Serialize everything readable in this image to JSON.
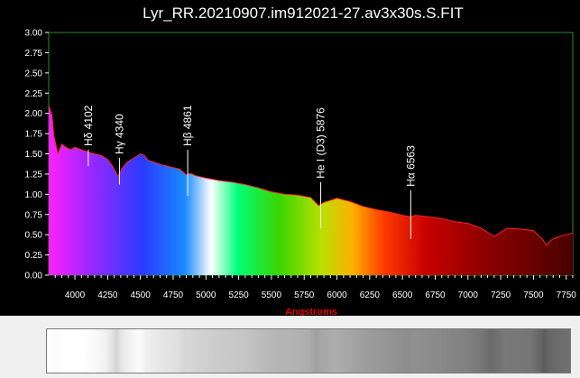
{
  "chart_data": {
    "type": "area",
    "title": "Lyr_RR.20210907.im912021-27.av3x30s.S.FIT",
    "xlabel": "Angstroms",
    "ylabel": "",
    "xlim": [
      3800,
      7800
    ],
    "ylim": [
      0,
      3.0
    ],
    "grid": false,
    "x_ticks": [
      4000,
      4250,
      4500,
      4750,
      5000,
      5250,
      5500,
      5750,
      6000,
      6250,
      6500,
      6750,
      7000,
      7250,
      7500,
      7750
    ],
    "y_ticks": [
      "0.00",
      "0.25",
      "0.50",
      "0.75",
      "1.00",
      "1.25",
      "1.50",
      "1.75",
      "2.00",
      "2.25",
      "2.50",
      "2.75",
      "3.00"
    ],
    "series": [
      {
        "points": [
          [
            3800,
            2.1
          ],
          [
            3825,
            1.98
          ],
          [
            3840,
            1.72
          ],
          [
            3870,
            1.5
          ],
          [
            3900,
            1.62
          ],
          [
            3930,
            1.58
          ],
          [
            3970,
            1.55
          ],
          [
            4000,
            1.58
          ],
          [
            4050,
            1.55
          ],
          [
            4100,
            1.52
          ],
          [
            4150,
            1.5
          ],
          [
            4200,
            1.48
          ],
          [
            4250,
            1.43
          ],
          [
            4290,
            1.34
          ],
          [
            4330,
            1.22
          ],
          [
            4360,
            1.32
          ],
          [
            4400,
            1.4
          ],
          [
            4450,
            1.45
          ],
          [
            4500,
            1.5
          ],
          [
            4530,
            1.48
          ],
          [
            4560,
            1.42
          ],
          [
            4600,
            1.4
          ],
          [
            4650,
            1.37
          ],
          [
            4700,
            1.35
          ],
          [
            4750,
            1.33
          ],
          [
            4800,
            1.31
          ],
          [
            4850,
            1.24
          ],
          [
            4880,
            1.26
          ],
          [
            4920,
            1.23
          ],
          [
            5000,
            1.2
          ],
          [
            5100,
            1.17
          ],
          [
            5200,
            1.15
          ],
          [
            5300,
            1.12
          ],
          [
            5400,
            1.08
          ],
          [
            5500,
            1.03
          ],
          [
            5600,
            1.0
          ],
          [
            5700,
            0.99
          ],
          [
            5800,
            0.96
          ],
          [
            5860,
            0.86
          ],
          [
            5900,
            0.9
          ],
          [
            6000,
            0.95
          ],
          [
            6100,
            0.91
          ],
          [
            6200,
            0.85
          ],
          [
            6300,
            0.81
          ],
          [
            6400,
            0.78
          ],
          [
            6500,
            0.74
          ],
          [
            6563,
            0.72
          ],
          [
            6600,
            0.74
          ],
          [
            6700,
            0.72
          ],
          [
            6800,
            0.7
          ],
          [
            6900,
            0.66
          ],
          [
            7000,
            0.64
          ],
          [
            7100,
            0.58
          ],
          [
            7150,
            0.53
          ],
          [
            7200,
            0.48
          ],
          [
            7300,
            0.58
          ],
          [
            7400,
            0.57
          ],
          [
            7500,
            0.55
          ],
          [
            7570,
            0.44
          ],
          [
            7600,
            0.37
          ],
          [
            7640,
            0.44
          ],
          [
            7700,
            0.48
          ],
          [
            7750,
            0.5
          ],
          [
            7800,
            0.52
          ]
        ]
      }
    ],
    "annotations": [
      {
        "label": "Hδ 4102",
        "x": 4102,
        "top": 1.55,
        "bottom": 1.35
      },
      {
        "label": "Hγ 4340",
        "x": 4340,
        "top": 1.45,
        "bottom": 1.12
      },
      {
        "label": "Hβ 4861",
        "x": 4861,
        "top": 1.55,
        "bottom": 0.98
      },
      {
        "label": "He I (D3) 5876",
        "x": 5876,
        "top": 1.15,
        "bottom": 0.58
      },
      {
        "label": "Hα 6563",
        "x": 6563,
        "top": 1.05,
        "bottom": 0.45
      }
    ],
    "colors": {
      "background": "#000000",
      "axes": "#2a8a2a",
      "outline": "#ff2020",
      "annotation": "#ffffff",
      "xlabel": "#e00000"
    }
  }
}
